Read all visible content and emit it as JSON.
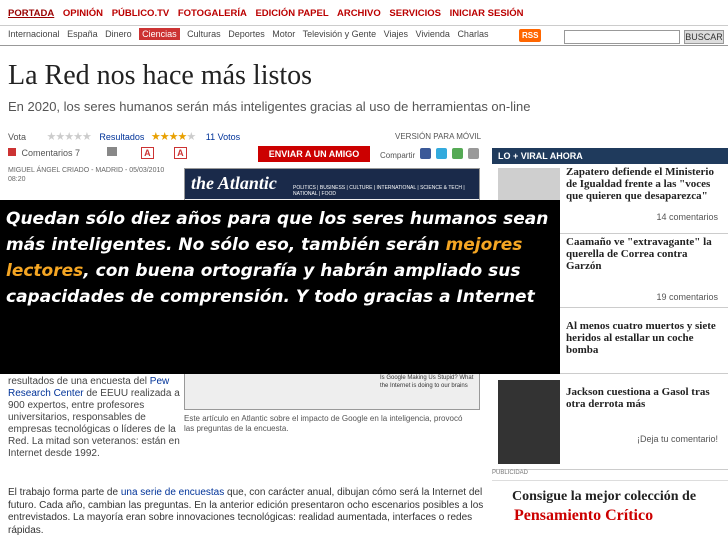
{
  "topnav": [
    "PORTADA",
    "OPINIÓN",
    "PÚBLICO.TV",
    "FOTOGALERÍA",
    "EDICIÓN PAPEL",
    "ARCHIVO",
    "SERVICIOS",
    "INICIAR SESIÓN"
  ],
  "subnav": [
    "Internacional",
    "España",
    "Dinero",
    "Ciencias",
    "Culturas",
    "Deportes",
    "Motor",
    "Televisión y Gente",
    "Viajes",
    "Vivienda",
    "Charlas"
  ],
  "rss": "RSS",
  "search_btn": "BUSCAR",
  "article": {
    "title": "La Red nos hace más listos",
    "subtitle": "En 2020, los seres humanos serán más inteligentes gracias al uso de herramientas on-line",
    "vota": "Vota",
    "resultados": "Resultados",
    "votos": "11 Votos",
    "rating_stars": 4,
    "version_movil": "VERSIÓN PARA MÓVIL",
    "comentarios": "Comentarios 7",
    "font_a1": "A",
    "font_a2": "A",
    "enviar": "ENVIAR A UN AMIGO",
    "compartir": "Compartir",
    "byline": "MIGUEL ÁNGEL CRIADO - MADRID - 05/03/2010 08:20",
    "atlantic_logo": "the Atlantic",
    "atlantic_menu": "POLITICS | BUSINESS | CULTURE | INTERNATIONAL | SCIENCE & TECH | NATIONAL | FOOD",
    "atlantic_body": "Is Google Making Us Stupid? What the Internet is doing to our brains",
    "caption": "Este artículo en Atlantic sobre el impacto de Google en la inteligencia, provocó las preguntas de la encuesta.",
    "left_text_1": "resultados de una encuesta del",
    "left_link": "Pew Research Center",
    "left_text_2": "de EEUU realizada a 900 expertos, entre profesores universitarios, responsables de empresas tecnológicas o líderes de la Red. La mitad son veteranos: están en Internet desde 1992.",
    "para_1": "El trabajo forma parte de",
    "para_link": "una serie de encuestas",
    "para_2": "que, con carácter anual, dibujan cómo será la Internet del futuro. Cada año, cambian las preguntas. En la anterior edición presentaron ocho escenarios posibles a los entrevistados. La mayoría eran sobre innovaciones tecnológicas: realidad aumentada, interfaces o redes rápidas."
  },
  "overlay": {
    "text_1": "Quedan sólo diez años para que los seres humanos sean más inteligentes. No sólo eso, también serán",
    "highlight": "mejores lectores",
    "text_2": ", con buena ortografía y habrán ampliado sus capacidades de comprensión. Y todo gracias a Internet"
  },
  "sidebar": {
    "header": "LO + VIRAL AHORA",
    "items": [
      {
        "headline": "Zapatero defiende el Ministerio de Igualdad frente a las \"voces que quieren que desaparezca\"",
        "count": "14 comentarios"
      },
      {
        "headline": "Caamaño ve \"extravagante\" la querella de Correa contra Garzón",
        "count": "19 comentarios"
      },
      {
        "headline": "Al menos cuatro muertos y siete heridos al estallar un coche bomba",
        "count": ""
      },
      {
        "headline": "Jackson cuestiona a Gasol tras otra derrota más",
        "count": "¡Deja tu comentario!"
      }
    ]
  },
  "publicidad": "PUBLICIDAD",
  "ad": {
    "line1": "Consigue la mejor colección de",
    "line2": "Pensamiento Crítico"
  }
}
